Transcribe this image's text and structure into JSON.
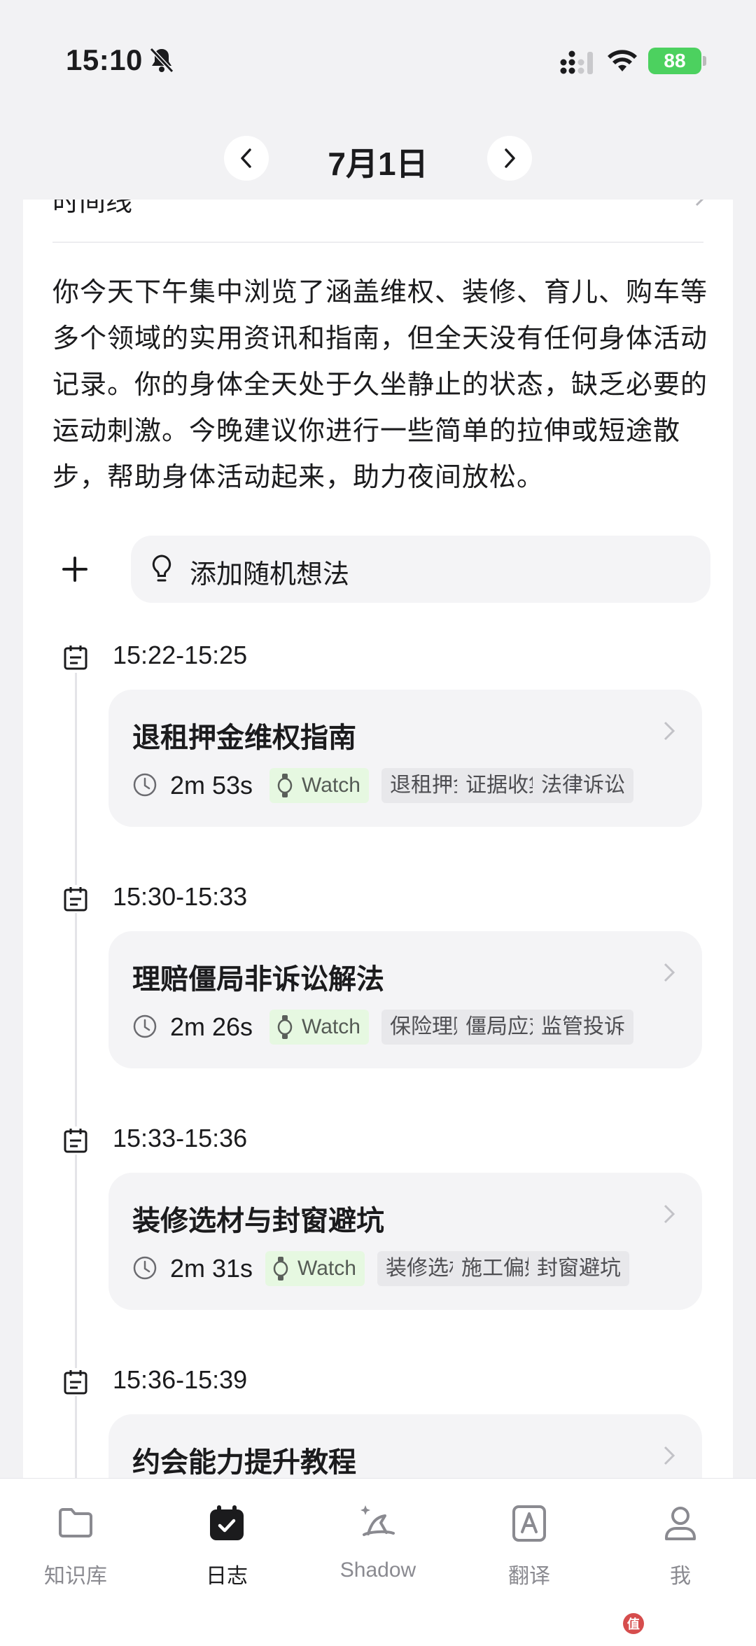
{
  "status_bar": {
    "time": "15:10",
    "battery": "88"
  },
  "header": {
    "date": "7月1日"
  },
  "clipped_heading": "时间线",
  "summary": "你今天下午集中浏览了涵盖维权、装修、育儿、购车等多个领域的实用资讯和指南，但全天没有任何身体活动记录。你的身体全天处于久坐静止的状态，缺乏必要的运动刺激。今晚建议你进行一些简单的拉伸或短途散步，帮助身体活动起来，助力夜间放松。",
  "add_idea": {
    "label": "添加随机想法"
  },
  "entries": [
    {
      "time": "15:22-15:25",
      "title": "退租押金维权指南",
      "duration": "2m 53s",
      "device": "Watch",
      "tags": [
        "退租押金",
        "证据收集",
        "法律诉讼"
      ]
    },
    {
      "time": "15:30-15:33",
      "title": "理赔僵局非诉讼解法",
      "duration": "2m 26s",
      "device": "Watch",
      "tags": [
        "保险理赔",
        "僵局应对",
        "监管投诉"
      ]
    },
    {
      "time": "15:33-15:36",
      "title": "装修选材与封窗避坑",
      "duration": "2m 31s",
      "device": "Watch",
      "tags": [
        "装修选材",
        "施工偏好",
        "封窗避坑"
      ]
    },
    {
      "time": "15:36-15:39",
      "title": "约会能力提升教程",
      "duration": "",
      "device": "",
      "tags": []
    }
  ],
  "tabs": [
    {
      "label": "知识库",
      "icon": "folder-icon"
    },
    {
      "label": "日志",
      "icon": "calendar-check-icon",
      "active": true
    },
    {
      "label": "Shadow",
      "icon": "shadow-wizard-hat-icon"
    },
    {
      "label": "翻译",
      "icon": "translate-icon"
    },
    {
      "label": "我",
      "icon": "profile-icon"
    }
  ],
  "watermark": "值 什么值得买"
}
